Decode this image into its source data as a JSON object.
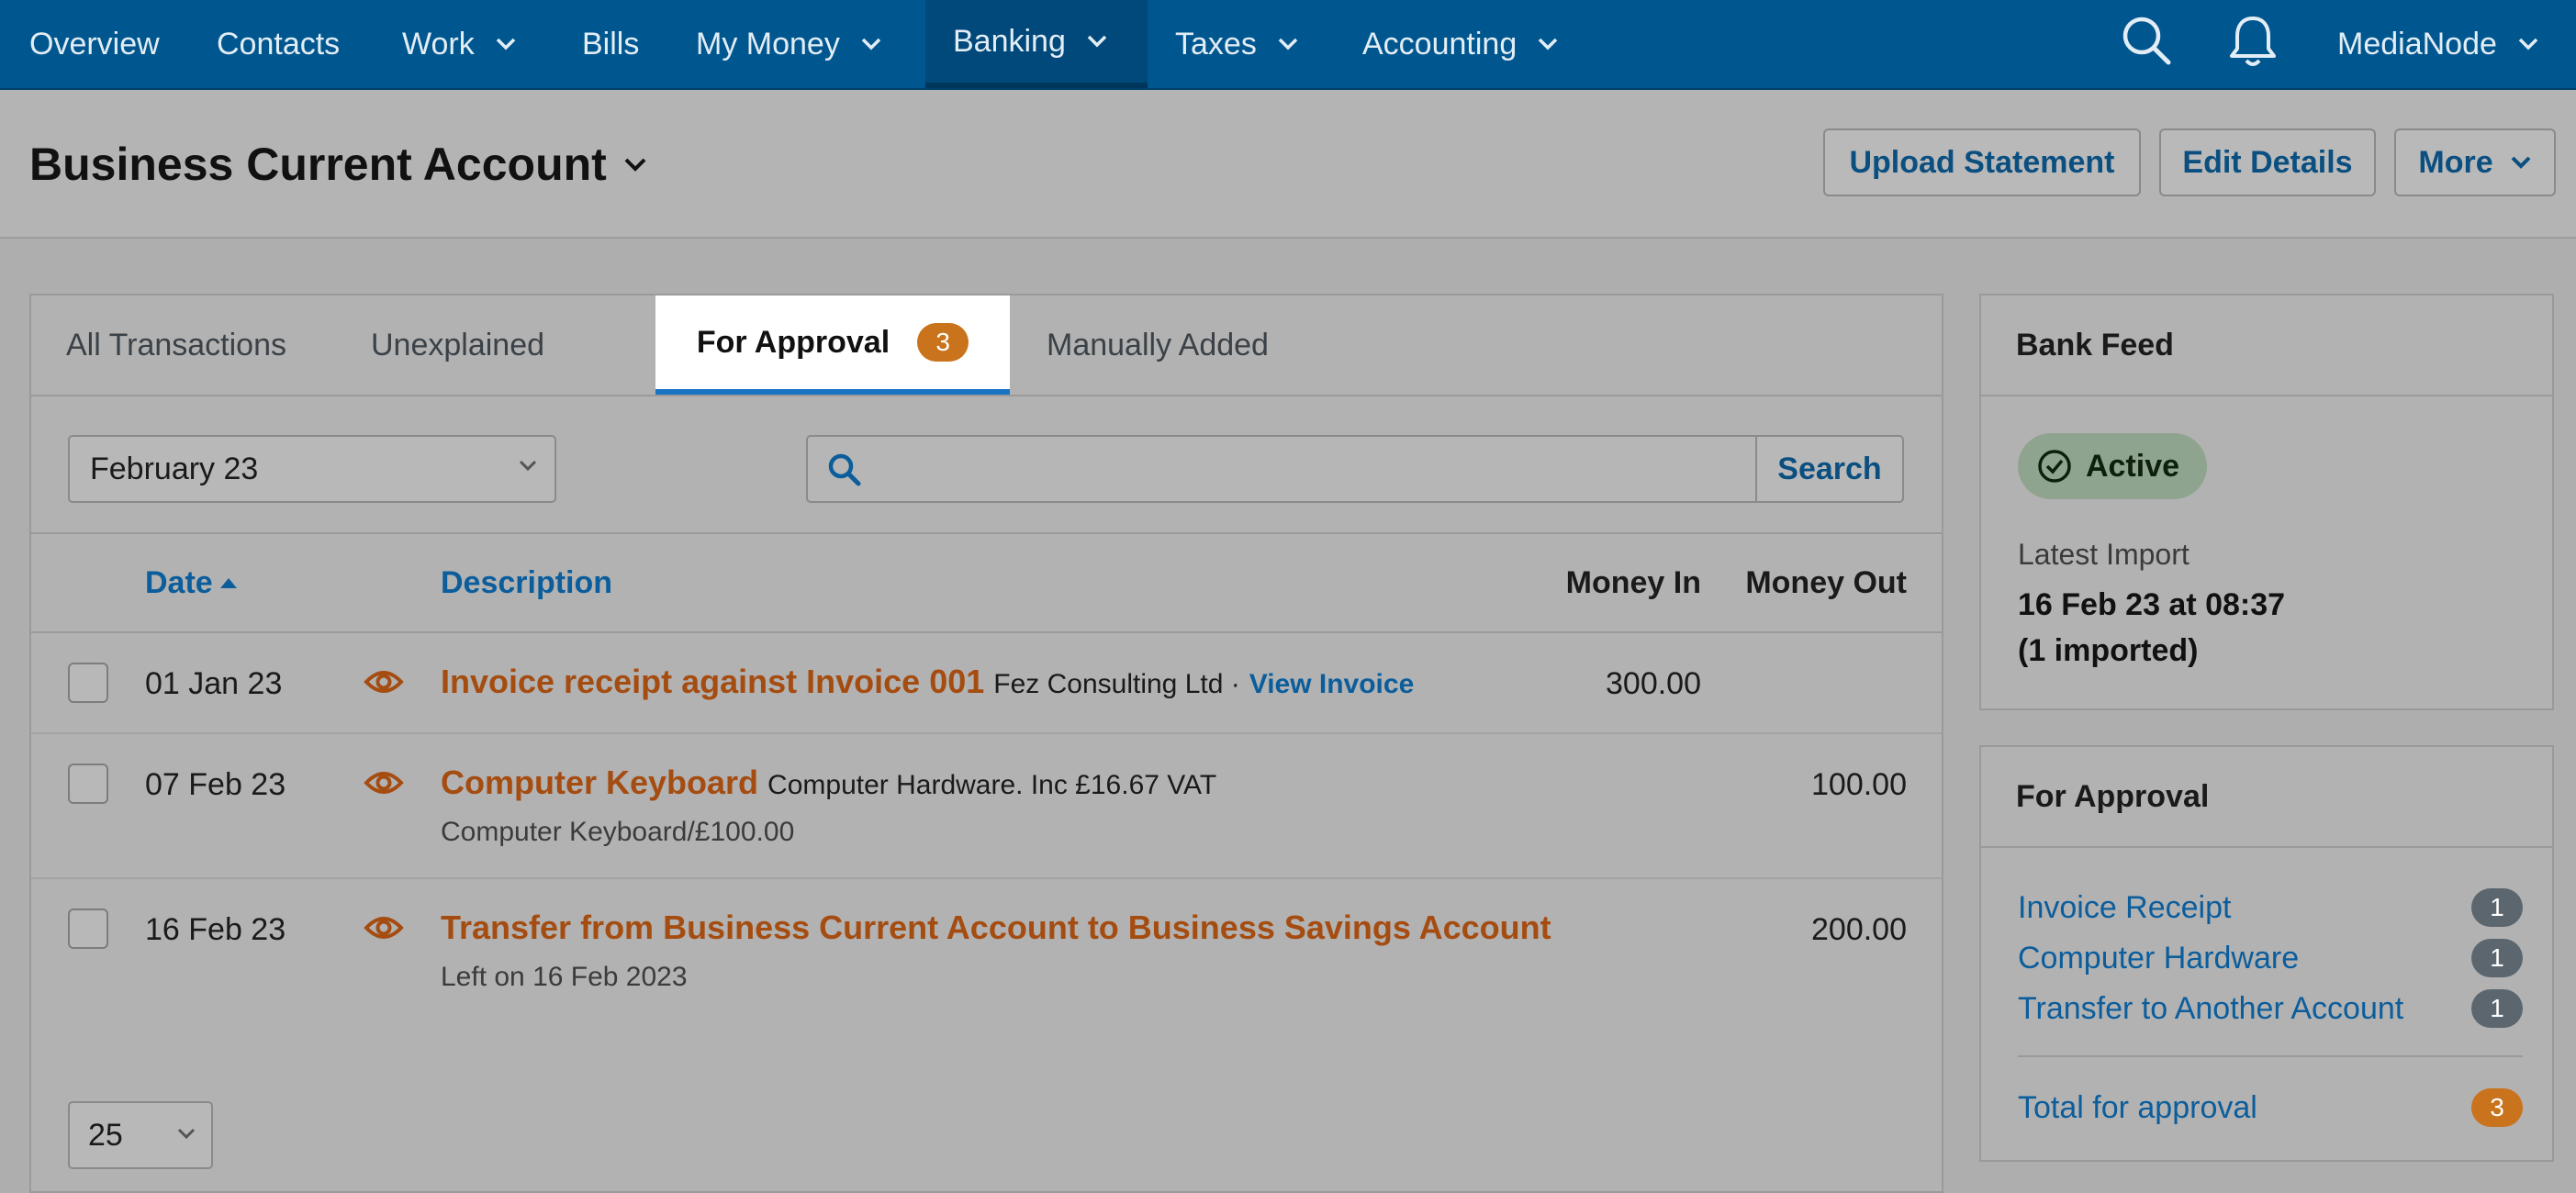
{
  "nav": {
    "items": [
      {
        "label": "Overview"
      },
      {
        "label": "Contacts"
      },
      {
        "label": "Work"
      },
      {
        "label": "Bills"
      },
      {
        "label": "My Money"
      },
      {
        "label": "Banking"
      },
      {
        "label": "Taxes"
      },
      {
        "label": "Accounting"
      }
    ],
    "active": "Banking",
    "user": "MediaNode",
    "icons": [
      "search-icon",
      "bell-icon",
      "chevron-down-icon"
    ]
  },
  "header": {
    "title": "Business Current Account",
    "buttons": {
      "upload": "Upload Statement",
      "edit": "Edit Details",
      "more": "More"
    }
  },
  "tabs": {
    "all": "All Transactions",
    "unexplained": "Unexplained",
    "approval": "For Approval",
    "approval_count": "3",
    "manual": "Manually Added"
  },
  "filters": {
    "month": "February 23",
    "search_placeholder": "",
    "search_button": "Search"
  },
  "table": {
    "headers": {
      "date": "Date",
      "description": "Description",
      "money_in": "Money In",
      "money_out": "Money Out"
    },
    "rows": [
      {
        "date": "01 Jan 23",
        "title": "Invoice receipt against Invoice 001",
        "meta": "Fez Consulting Ltd ·",
        "link": "View Invoice",
        "sub": "",
        "money_in": "300.00",
        "money_out": ""
      },
      {
        "date": "07 Feb 23",
        "title": "Computer Keyboard",
        "meta": "Computer Hardware. Inc £16.67 VAT",
        "link": "",
        "sub": "Computer Keyboard/£100.00",
        "money_in": "",
        "money_out": "100.00"
      },
      {
        "date": "16 Feb 23",
        "title": "Transfer from Business Current Account to Business Savings Account",
        "meta": "",
        "link": "",
        "sub": "Left on 16 Feb 2023",
        "money_in": "",
        "money_out": "200.00"
      }
    ],
    "per_page": "25"
  },
  "sidebar": {
    "bank_feed": {
      "title": "Bank Feed",
      "status": "Active",
      "latest_label": "Latest Import",
      "latest_value": "16 Feb 23 at 08:37",
      "latest_count": "(1 imported)"
    },
    "approval": {
      "title": "For Approval",
      "items": [
        {
          "label": "Invoice Receipt",
          "count": "1"
        },
        {
          "label": "Computer Hardware",
          "count": "1"
        },
        {
          "label": "Transfer to Another Account",
          "count": "1"
        }
      ],
      "total_label": "Total for approval",
      "total_count": "3"
    }
  },
  "colors": {
    "nav_bg": "#00578f",
    "link": "#0b5d9c",
    "desc_title": "#a54c11",
    "badge_orange": "#c9731c",
    "tab_active_bar": "#1873c4"
  }
}
